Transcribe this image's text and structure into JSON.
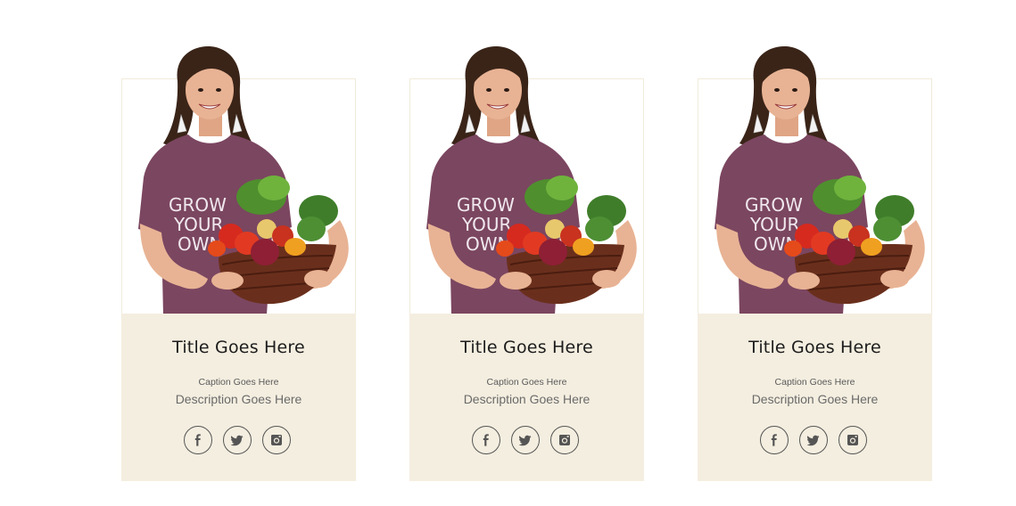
{
  "cards": [
    {
      "title": "Title Goes Here",
      "caption": "Caption Goes Here",
      "description": "Description Goes Here",
      "photo_alt": "Woman holding a basket of vegetables",
      "shirt_text": [
        "GROW",
        "YOUR",
        "OWN"
      ],
      "social": [
        "facebook-icon",
        "twitter-icon",
        "instagram-icon"
      ]
    },
    {
      "title": "Title Goes Here",
      "caption": "Caption Goes Here",
      "description": "Description Goes Here",
      "photo_alt": "Woman holding a basket of vegetables",
      "shirt_text": [
        "GROW",
        "YOUR",
        "OWN"
      ],
      "social": [
        "facebook-icon",
        "twitter-icon",
        "instagram-icon"
      ]
    },
    {
      "title": "Title Goes Here",
      "caption": "Caption Goes Here",
      "description": "Description Goes Here",
      "photo_alt": "Woman holding a basket of vegetables",
      "shirt_text": [
        "GROW",
        "YOUR",
        "OWN"
      ],
      "social": [
        "facebook-icon",
        "twitter-icon",
        "instagram-icon"
      ]
    }
  ],
  "colors": {
    "info_bg": "#f4eee0",
    "border": "#f1ebdb",
    "icon_stroke": "#555555",
    "shirt": "#7b4660",
    "hair": "#3a2418",
    "skin": "#e8b394"
  }
}
